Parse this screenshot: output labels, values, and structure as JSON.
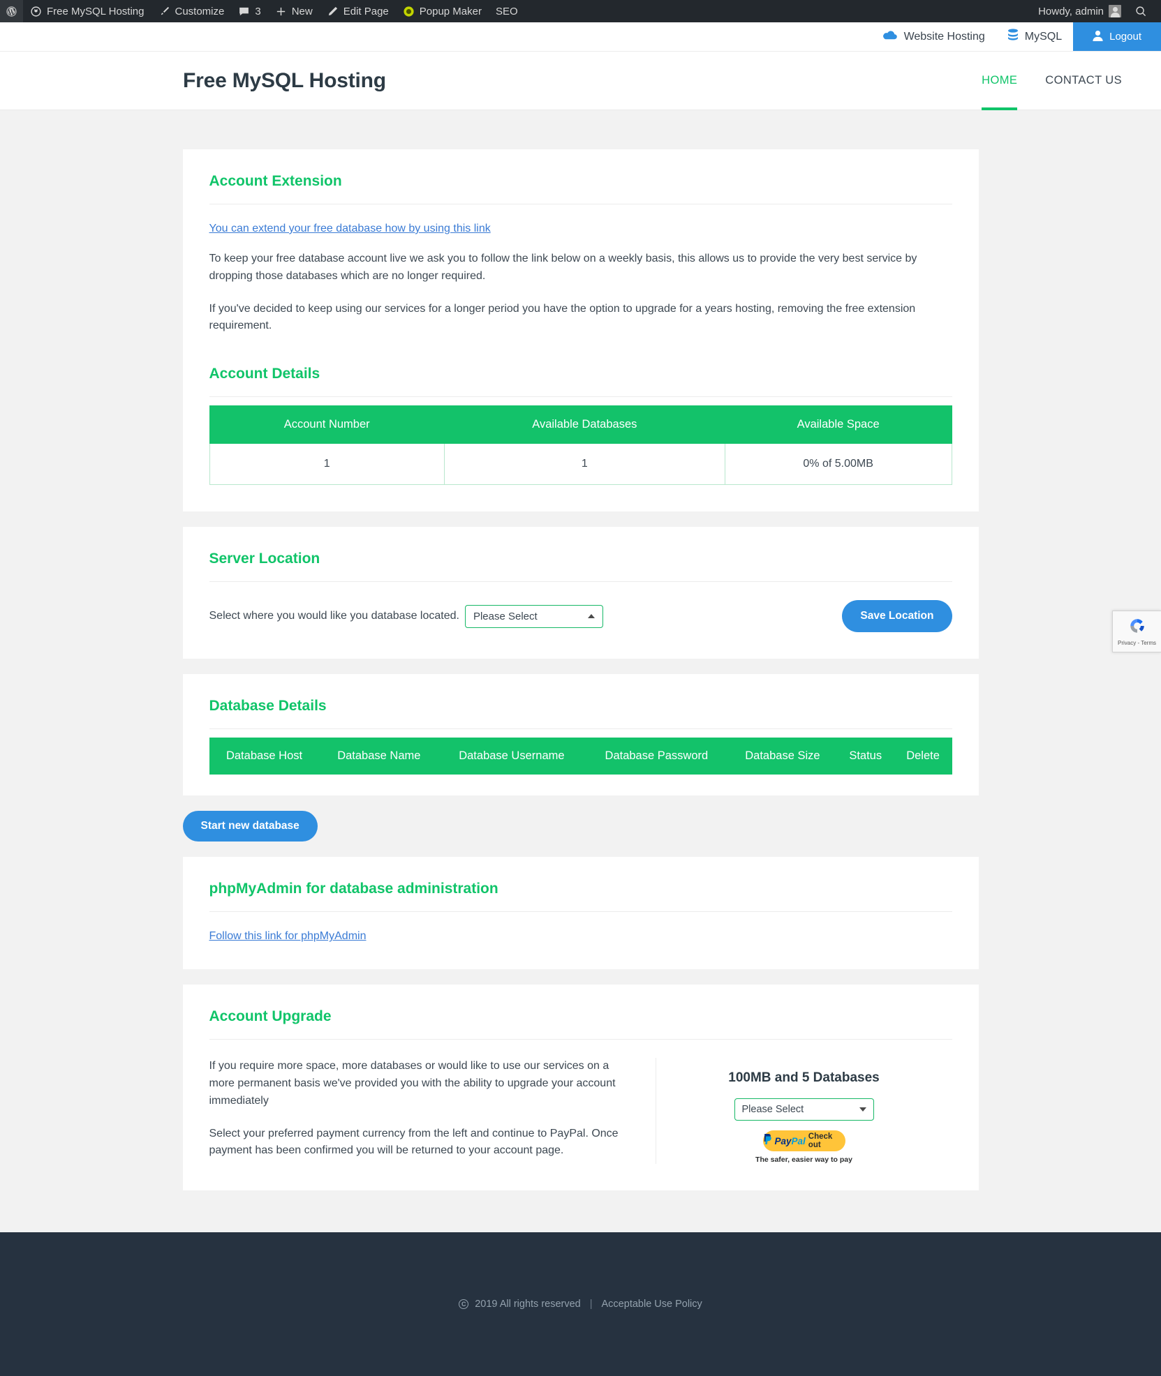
{
  "adminbar": {
    "items": [
      {
        "icon": "wordpress-logo-icon",
        "label": ""
      },
      {
        "icon": "site-icon",
        "label": "Free MySQL Hosting"
      },
      {
        "icon": "brush-icon",
        "label": "Customize"
      },
      {
        "icon": "comment-icon",
        "label": "3"
      },
      {
        "icon": "plus-icon",
        "label": "New"
      },
      {
        "icon": "pencil-icon",
        "label": "Edit Page"
      },
      {
        "icon": "popup-maker-icon",
        "label": "Popup Maker"
      },
      {
        "icon": "",
        "label": "SEO"
      }
    ],
    "howdy": "Howdy, admin",
    "avatar_icon": "avatar-icon",
    "search_icon": "search-icon"
  },
  "utility_bar": {
    "website_hosting": "Website Hosting",
    "website_hosting_icon": "cloud-icon",
    "mysql": "MySQL",
    "mysql_icon": "database-icon",
    "logout": "Logout",
    "logout_icon": "user-icon"
  },
  "header": {
    "site_title": "Free MySQL Hosting",
    "nav": [
      {
        "label": "HOME",
        "active": true
      },
      {
        "label": "CONTACT US",
        "active": false
      }
    ]
  },
  "account_extension": {
    "title": "Account Extension",
    "link": "You can extend your free database how by using this link",
    "paragraph1": "To keep your free database account live we ask you to follow the link below on a weekly basis, this allows us to provide the very best service by dropping those databases which are no longer required.",
    "paragraph2": "If you've decided to keep using our services for a longer period you have the option to upgrade for a years hosting, removing the free extension requirement."
  },
  "account_details": {
    "title": "Account Details",
    "columns": [
      "Account Number",
      "Available Databases",
      "Available Space"
    ],
    "rows": [
      [
        "1",
        "1",
        "0% of 5.00MB"
      ]
    ]
  },
  "server_location": {
    "title": "Server Location",
    "label": "Select where you would like you database located.",
    "select_value": "Please Select",
    "caret_icon": "caret-up-icon",
    "save_button": "Save Location"
  },
  "database_details": {
    "title": "Database Details",
    "columns": [
      "Database Host",
      "Database Name",
      "Database Username",
      "Database Password",
      "Database Size",
      "Status",
      "Delete"
    ],
    "rows": []
  },
  "start_new_database_button": "Start new database",
  "phpmyadmin": {
    "title": "phpMyAdmin for database administration",
    "link": "Follow this link for phpMyAdmin"
  },
  "account_upgrade": {
    "title": "Account Upgrade",
    "paragraph1": "If you require more space, more databases or would like to use our services on a more permanent basis we've provided you with the ability to upgrade your account immediately",
    "paragraph2": "Select your preferred payment currency from the left and continue to PayPal. Once payment has been confirmed you will be returned to your account page.",
    "plan_title": "100MB and 5 Databases",
    "select_value": "Please Select",
    "caret_icon": "caret-down-icon",
    "paypal": {
      "logo_pay": "Pay",
      "logo_pal": "Pal",
      "checkout": "Check out",
      "tagline": "The safer, easier way to pay"
    }
  },
  "recaptcha": {
    "text": "Privacy - Terms",
    "icon": "recaptcha-icon"
  },
  "footer": {
    "copyright_symbol": "C",
    "copyright": "2019 All rights reserved",
    "separator": "|",
    "policy_link": "Acceptable Use Policy"
  },
  "colors": {
    "green": "#10c469",
    "table_green": "#13c26a",
    "blue": "#2f8fe0",
    "link_blue": "#3a7bd5",
    "footer_bg": "#263240",
    "page_bg": "#f2f2f2",
    "adminbar_bg": "#23282d"
  }
}
